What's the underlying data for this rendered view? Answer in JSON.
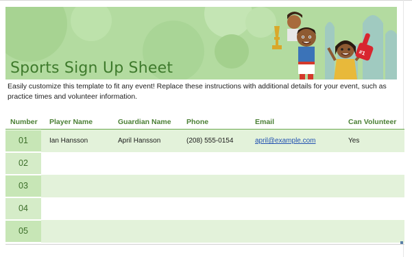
{
  "banner": {
    "title": "Sports Sign Up Sheet"
  },
  "instructions": "Easily customize this template to fit any event! Replace these instructions with additional details for your event, such as practice times and volunteer information.",
  "table": {
    "headers": [
      "Number",
      "Player Name",
      "Guardian Name",
      "Phone",
      "Email",
      "Can Volunteer"
    ],
    "rows": [
      {
        "number": "01",
        "player": "Ian Hansson",
        "guardian": "April Hansson",
        "phone": "(208) 555-0154",
        "email": "april@example.com",
        "volunteer": "Yes"
      },
      {
        "number": "02",
        "player": "",
        "guardian": "",
        "phone": "",
        "email": "",
        "volunteer": ""
      },
      {
        "number": "03",
        "player": "",
        "guardian": "",
        "phone": "",
        "email": "",
        "volunteer": ""
      },
      {
        "number": "04",
        "player": "",
        "guardian": "",
        "phone": "",
        "email": "",
        "volunteer": ""
      },
      {
        "number": "05",
        "player": "",
        "guardian": "",
        "phone": "",
        "email": "",
        "volunteer": ""
      }
    ]
  },
  "colors": {
    "banner_bg": "#b3dba0",
    "title": "#3e7a2c",
    "header_text": "#4a7f34",
    "row_band": "#e3f2da",
    "number_cell": "#c7e6b6",
    "link": "#1f4fb0"
  }
}
